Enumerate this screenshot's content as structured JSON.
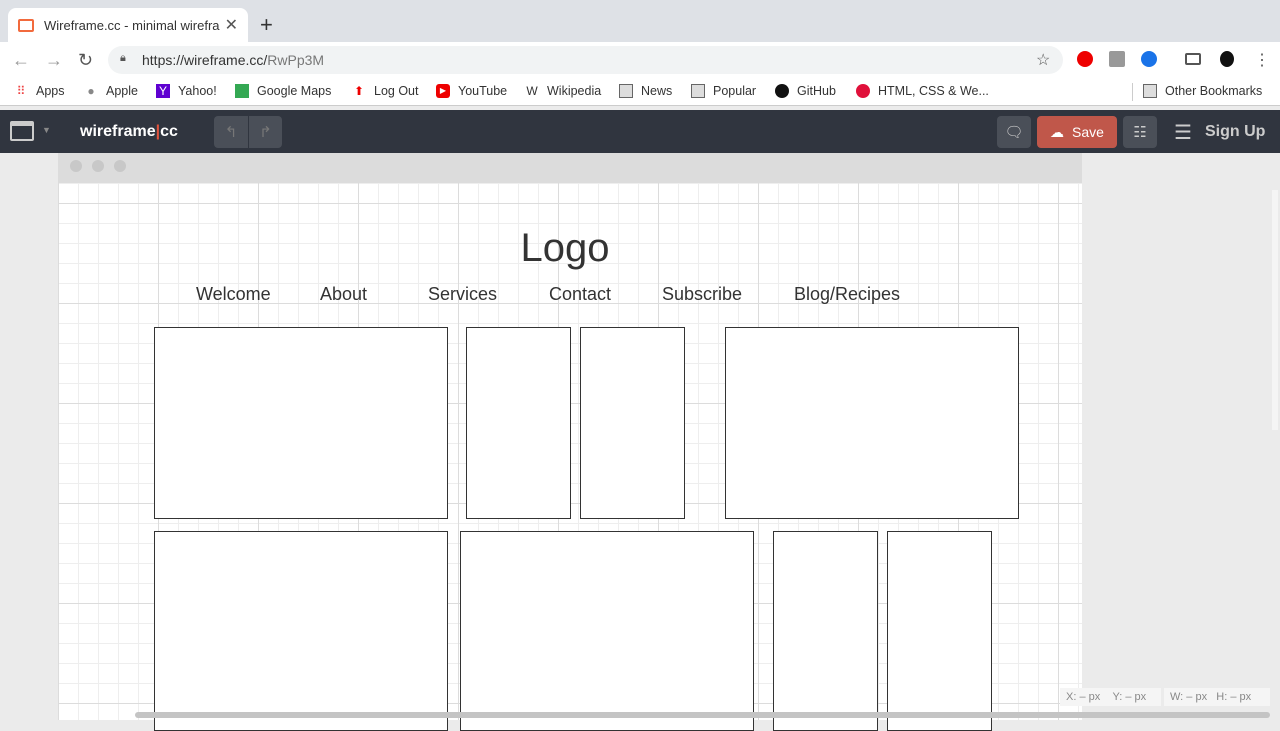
{
  "browser": {
    "tab_title": "Wireframe.cc - minimal wirefra",
    "url_host": "https://wireframe.cc/",
    "url_path": "RwPp3M",
    "bookmarks": [
      "Apps",
      "Apple",
      "Yahoo!",
      "Google Maps",
      "Log Out",
      "YouTube",
      "Wikipedia",
      "News",
      "Popular",
      "GitHub",
      "HTML, CSS & We..."
    ],
    "other_bookmarks": "Other Bookmarks"
  },
  "app": {
    "logo_left": "wireframe",
    "logo_sep": "|",
    "logo_right": "cc",
    "save_label": "Save",
    "signup_label": "Sign Up",
    "accent": "#c0574a"
  },
  "wireframe": {
    "logo": "Logo",
    "menu": [
      "Welcome",
      "About",
      "Services",
      "Contact",
      "Subscribe",
      "Blog/Recipes"
    ]
  },
  "status": {
    "x": "X: – px",
    "y": "Y: – px",
    "w": "W: – px",
    "h": "H: – px"
  }
}
